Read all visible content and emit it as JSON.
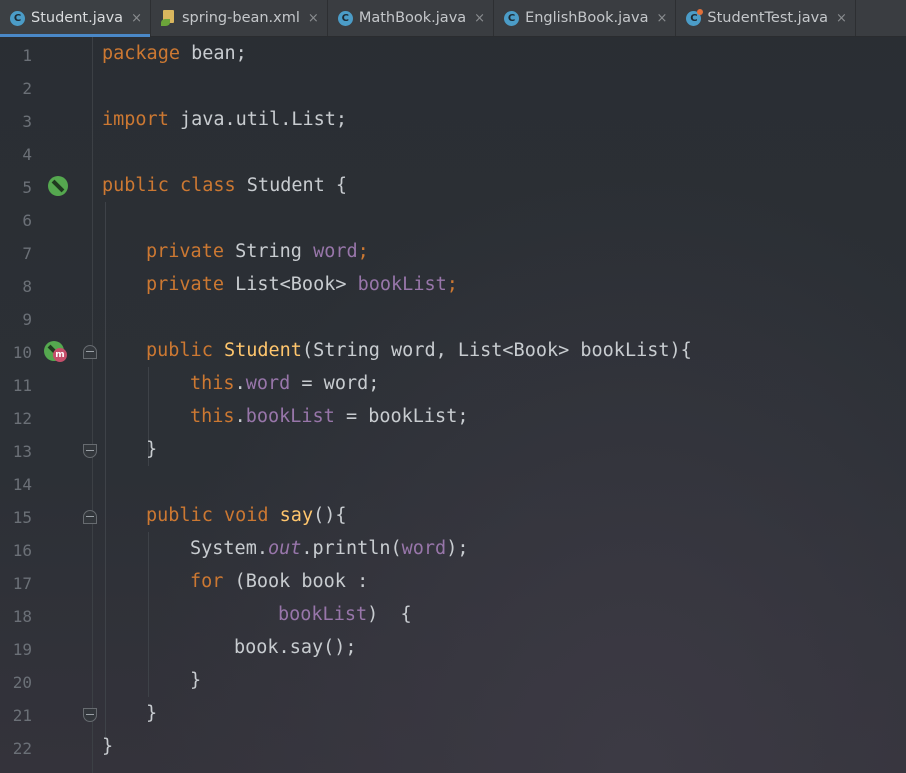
{
  "tabs": [
    {
      "label": "Student.java",
      "icon": "java-class-icon",
      "active": true
    },
    {
      "label": "spring-bean.xml",
      "icon": "spring-xml-icon",
      "active": false
    },
    {
      "label": "MathBook.java",
      "icon": "java-class-icon",
      "active": false
    },
    {
      "label": "EnglishBook.java",
      "icon": "java-class-icon",
      "active": false
    },
    {
      "label": "StudentTest.java",
      "icon": "java-test-class-icon",
      "active": false
    }
  ],
  "close_glyph": "×",
  "class_icon_letter": "C",
  "method_badge_letter": "m",
  "line_numbers": [
    "1",
    "2",
    "3",
    "4",
    "5",
    "6",
    "7",
    "8",
    "9",
    "10",
    "11",
    "12",
    "13",
    "14",
    "15",
    "16",
    "17",
    "18",
    "19",
    "20",
    "21",
    "22"
  ],
  "code": {
    "l1": {
      "kw": "package",
      "rest": " bean;"
    },
    "l3": {
      "kw": "import",
      "rest": " java.util.List;"
    },
    "l5": {
      "kw": "public class",
      "rest": " Student {"
    },
    "l7": {
      "kw": "private",
      "type": " String ",
      "field": "word",
      "end": ";"
    },
    "l8": {
      "kw": "private",
      "type": " List<Book> ",
      "field": "bookList",
      "end": ";"
    },
    "l10": {
      "kw": "public",
      "name": "Student",
      "rest": "(String word, List<Book> bookList){"
    },
    "l11": {
      "kw": "this",
      "dot": ".",
      "field": "word",
      "rest": " = word;"
    },
    "l12": {
      "kw": "this",
      "dot": ".",
      "field": "bookList",
      "rest": " = bookList;"
    },
    "l13": "}",
    "l15": {
      "kw": "public void",
      "name": "say",
      "rest": "(){"
    },
    "l16": {
      "pre": "System.",
      "static_field": "out",
      "call": ".println(",
      "field": "word",
      "end": ");"
    },
    "l17": {
      "kw": "for",
      "rest": " (Book book :"
    },
    "l18": {
      "field": "bookList",
      "rest": ")  {"
    },
    "l19": "book.say();",
    "l20": "}",
    "l21": "}",
    "l22": "}"
  },
  "colors": {
    "keyword": "#cc7832",
    "method": "#ffc66d",
    "field": "#9876aa",
    "text": "#c8ccd0",
    "line_number": "#6b7077",
    "tab_accent": "#4a88c7"
  }
}
